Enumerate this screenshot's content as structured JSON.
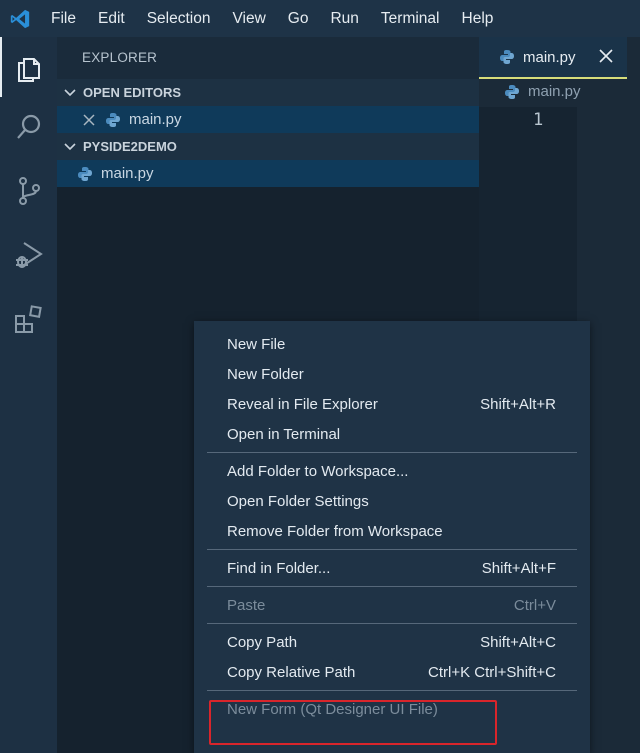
{
  "menubar": {
    "items": [
      "File",
      "Edit",
      "Selection",
      "View",
      "Go",
      "Run",
      "Terminal",
      "Help"
    ]
  },
  "activitybar": {
    "icons": [
      "explorer-icon",
      "search-icon",
      "source-control-icon",
      "run-debug-icon",
      "extensions-icon"
    ]
  },
  "sidebar": {
    "title": "EXPLORER",
    "open_editors": {
      "header": "OPEN EDITORS",
      "files": [
        "main.py"
      ]
    },
    "folder": {
      "header": "PYSIDE2DEMO",
      "files": [
        "main.py"
      ]
    }
  },
  "editor": {
    "tab_label": "main.py",
    "breadcrumb": "main.py",
    "line_number": "1"
  },
  "context_menu": {
    "groups": [
      [
        {
          "label": "New File",
          "shortcut": ""
        },
        {
          "label": "New Folder",
          "shortcut": ""
        },
        {
          "label": "Reveal in File Explorer",
          "shortcut": "Shift+Alt+R"
        },
        {
          "label": "Open in Terminal",
          "shortcut": ""
        }
      ],
      [
        {
          "label": "Add Folder to Workspace...",
          "shortcut": ""
        },
        {
          "label": "Open Folder Settings",
          "shortcut": ""
        },
        {
          "label": "Remove Folder from Workspace",
          "shortcut": ""
        }
      ],
      [
        {
          "label": "Find in Folder...",
          "shortcut": "Shift+Alt+F"
        }
      ],
      [
        {
          "label": "Paste",
          "shortcut": "Ctrl+V",
          "disabled": true
        }
      ],
      [
        {
          "label": "Copy Path",
          "shortcut": "Shift+Alt+C"
        },
        {
          "label": "Copy Relative Path",
          "shortcut": "Ctrl+K Ctrl+Shift+C"
        }
      ],
      [
        {
          "label": "New Form (Qt Designer UI File)",
          "shortcut": "",
          "disabled": true,
          "highlighted": true
        }
      ]
    ]
  },
  "colors": {
    "highlight_box": "#d9252b",
    "python_blue": "#4b8bbe",
    "vscode_blue": "#2a8fd8"
  }
}
